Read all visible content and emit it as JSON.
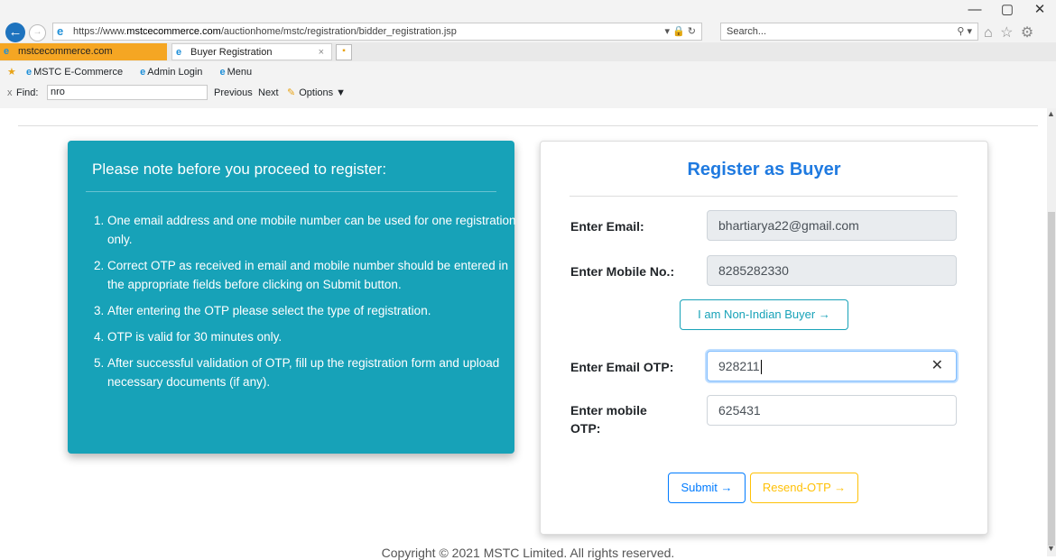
{
  "browser": {
    "window_controls": [
      "—",
      "▢",
      "✕"
    ],
    "url_prefix": "https://www.",
    "url_domain": "mstcecommerce.com",
    "url_path": "/auctionhome/mstc/registration/bidder_registration.jsp",
    "url_tools": "▾ 🔒 ↻",
    "search_placeholder": "Search...",
    "search_icon": "⚲ ▾",
    "nav_icons": "⌂ ☆ ⚙ ☺",
    "tabs": [
      {
        "label": "mstcecommerce.com"
      },
      {
        "label": "Buyer Registration"
      }
    ],
    "tab_close": "×",
    "favorites": [
      "MSTC E-Commerce",
      "Admin Login",
      "Menu"
    ],
    "find": {
      "close": "x",
      "label": "Find:",
      "value": "nro",
      "previous": "Previous",
      "next": "Next",
      "options": "Options ▼"
    }
  },
  "notes": {
    "title": "Please note before you proceed to register:",
    "items": [
      "One email address and one mobile number can be used for one registration only.",
      "Correct OTP as received in email and mobile number should be entered in the appropriate fields before clicking on Submit button.",
      "After entering the OTP please select the type of registration.",
      "OTP is valid for 30 minutes only.",
      "After successful validation of OTP, fill up the registration form and upload necessary documents (if any)."
    ]
  },
  "form": {
    "title": "Register as Buyer",
    "email_label": "Enter Email:",
    "email_value": "bhartiarya22@gmail.com",
    "mobile_label": "Enter Mobile No.:",
    "mobile_value": "8285282330",
    "non_indian_button": "I am Non-Indian Buyer →",
    "email_otp_label": "Enter Email OTP:",
    "email_otp_value": "928211",
    "clear_icon": "✕",
    "mobile_otp_label_1": "Enter mobile",
    "mobile_otp_label_2": "OTP:",
    "mobile_otp_value": "625431",
    "submit_button": "Submit →",
    "resend_button": "Resend-OTP →"
  },
  "footer": "Copyright © 2021 MSTC Limited. All rights reserved.",
  "colors": {
    "note_panel": "#17a2b8",
    "title_blue": "#1f7ae0",
    "primary": "#007bff",
    "warning": "#ffc107"
  }
}
